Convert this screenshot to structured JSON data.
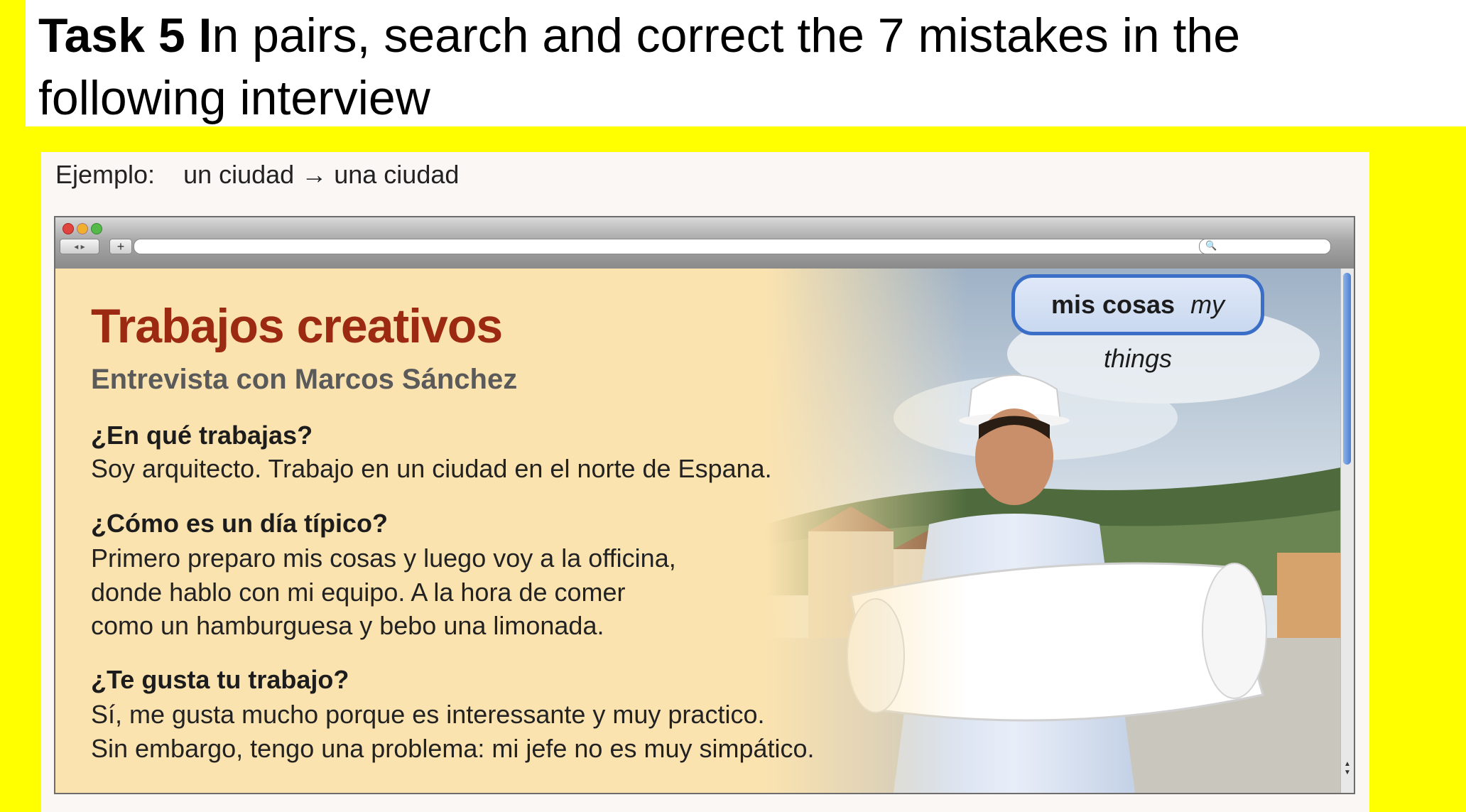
{
  "header": {
    "task_bold": "Task 5 I",
    "task_rest": "n pairs, search and correct the 7 mistakes in the following interview"
  },
  "example": {
    "label": "Ejemplo:",
    "wrong": "un ciudad",
    "arrow": "→",
    "right": "una ciudad"
  },
  "browser": {
    "nav_arrows": "◂ ▸",
    "new_tab": "+",
    "reload_icon": "↻",
    "search_icon": "🔍"
  },
  "article": {
    "title": "Trabajos creativos",
    "subtitle": "Entrevista con Marcos Sánchez",
    "q1": "¿En qué trabajas?",
    "a1": "Soy arquitecto. Trabajo en un ciudad en el norte de Espana.",
    "q2": "¿Cómo es un día típico?",
    "a2_line1": "Primero preparo mis cosas y luego voy a la officina,",
    "a2_line2": "donde hablo con mi equipo. A la hora de comer",
    "a2_line3": "como un hamburguesa y bebo una limonada.",
    "q3": "¿Te gusta tu trabajo?",
    "a3_line1": "Sí, me gusta mucho porque es interessante y muy practico.",
    "a3_line2": "Sin embargo, tengo una problema: mi jefe no es muy simpático."
  },
  "badge": {
    "spanish": "mis cosas",
    "english": "my things"
  }
}
